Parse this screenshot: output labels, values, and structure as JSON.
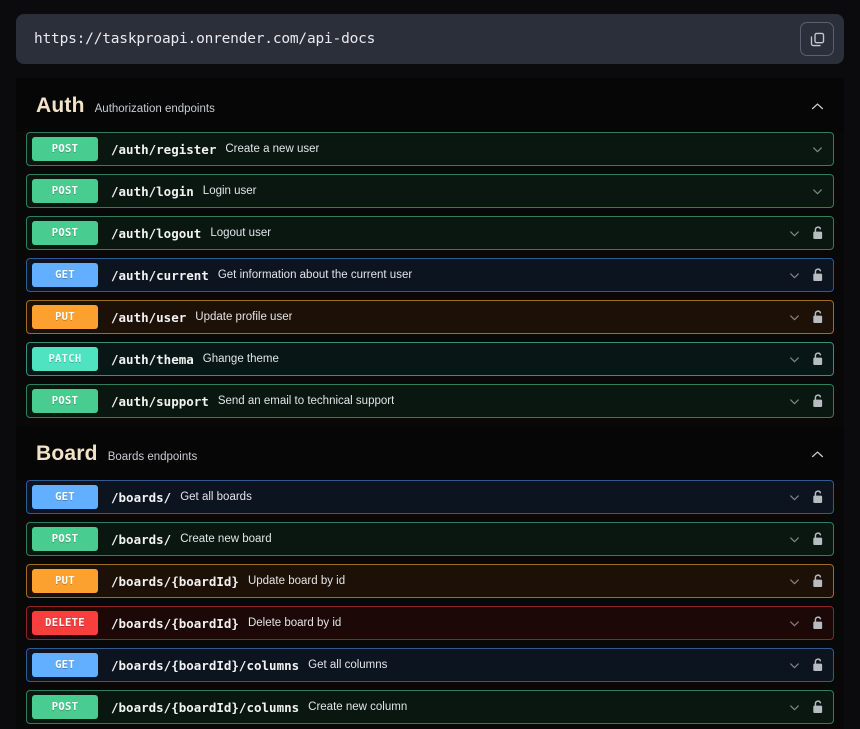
{
  "urlbar": {
    "url": "https://taskproapi.onrender.com/api-docs",
    "copy_icon": "copy-icon"
  },
  "colors": {
    "page_bg": "#0b0b0d",
    "urlbar_bg": "#2b2f3a",
    "section_title": "#f2e2c6",
    "get": "#61affe",
    "post": "#49cc90",
    "put": "#fca130",
    "patch": "#50e3c2",
    "delete": "#f93e3e"
  },
  "sections": [
    {
      "title": "Auth",
      "description": "Authorization endpoints",
      "collapse_icon": "chevron-up-icon",
      "expanded": true,
      "operations": [
        {
          "method": "POST",
          "path": "/auth/register",
          "summary": "Create a new user",
          "locked": false
        },
        {
          "method": "POST",
          "path": "/auth/login",
          "summary": "Login user",
          "locked": false
        },
        {
          "method": "POST",
          "path": "/auth/logout",
          "summary": "Logout user",
          "locked": true
        },
        {
          "method": "GET",
          "path": "/auth/current",
          "summary": "Get information about the current user",
          "locked": true
        },
        {
          "method": "PUT",
          "path": "/auth/user",
          "summary": "Update profile user",
          "locked": true
        },
        {
          "method": "PATCH",
          "path": "/auth/thema",
          "summary": "Ghange theme",
          "locked": true
        },
        {
          "method": "POST",
          "path": "/auth/support",
          "summary": "Send an email to technical support",
          "locked": true
        }
      ]
    },
    {
      "title": "Board",
      "description": "Boards endpoints",
      "collapse_icon": "chevron-up-icon",
      "expanded": true,
      "operations": [
        {
          "method": "GET",
          "path": "/boards/",
          "summary": "Get all boards",
          "locked": true
        },
        {
          "method": "POST",
          "path": "/boards/",
          "summary": "Create new board",
          "locked": true
        },
        {
          "method": "PUT",
          "path": "/boards/{boardId}",
          "summary": "Update board by id",
          "locked": true
        },
        {
          "method": "DELETE",
          "path": "/boards/{boardId}",
          "summary": "Delete board by id",
          "locked": true
        },
        {
          "method": "GET",
          "path": "/boards/{boardId}/columns",
          "summary": "Get all columns",
          "locked": true
        },
        {
          "method": "POST",
          "path": "/boards/{boardId}/columns",
          "summary": "Create new column",
          "locked": true
        }
      ]
    }
  ]
}
